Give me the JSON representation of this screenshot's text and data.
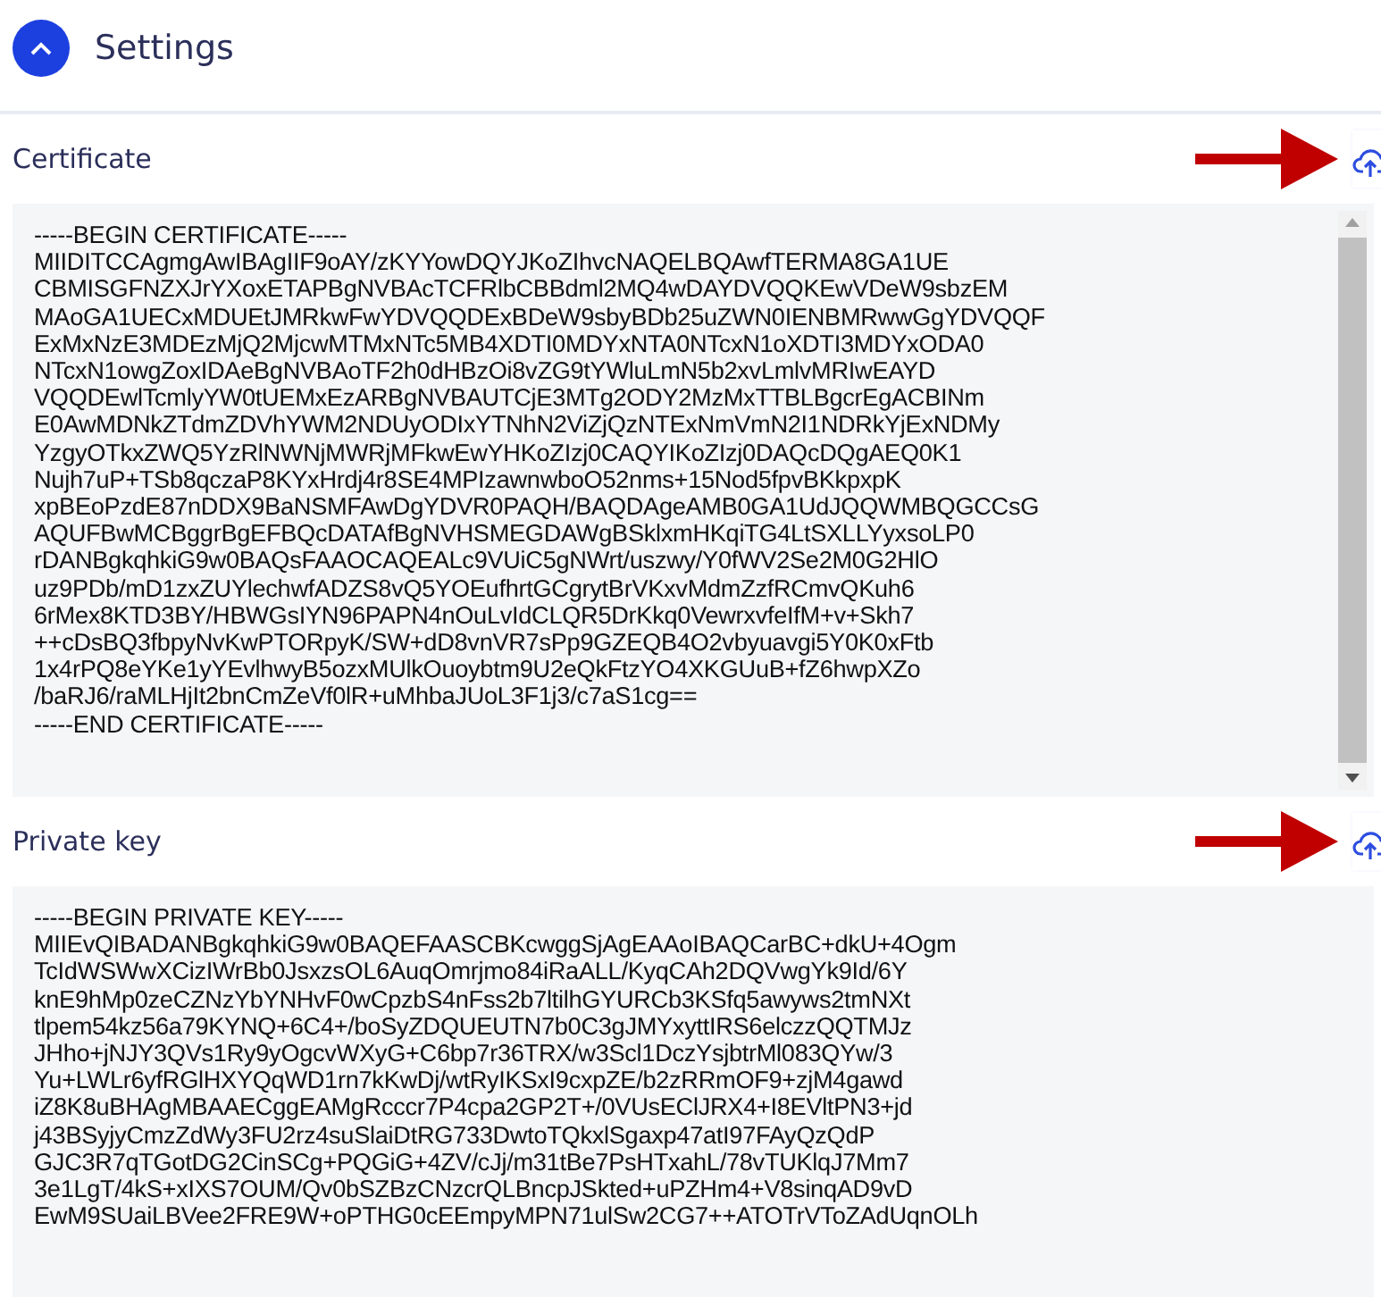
{
  "header": {
    "title": "Settings",
    "expanded": true
  },
  "fields": [
    {
      "label": "Certificate",
      "value": "-----BEGIN CERTIFICATE-----\nMIIDITCCAgmgAwIBAgIIF9oAY/zKYYowDQYJKoZIhvcNAQELBQAwfTERMA8GA1UE\nCBMISGFNZXJrYXoxETAPBgNVBAcTCFRlbCBBdml2MQ4wDAYDVQQKEwVDeW9sbzEM\nMAoGA1UECxMDUEtJMRkwFwYDVQQDExBDeW9sbyBDb25uZWN0IENBMRwwGgYDVQQF\nExMxNzE3MDEzMjQ2MjcwMTMxNTc5MB4XDTI0MDYxNTA0NTcxN1oXDTI3MDYxODA0\nNTcxN1owgZoxIDAeBgNVBAoTF2h0dHBzOi8vZG9tYWluLmN5b2xvLmlvMRIwEAYD\nVQQDEwlTcmlyYW0tUEMxEzARBgNVBAUTCjE3MTg2ODY2MzMxTTBLBgcrEgACBINm\nE0AwMDNkZTdmZDVhYWM2NDUyODIxYTNhN2ViZjQzNTExNmVmN2I1NDRkYjExNDMy\nYzgyOTkxZWQ5YzRlNWNjMWRjMFkwEwYHKoZIzj0CAQYIKoZIzj0DAQcDQgAEQ0K1\nNujh7uP+TSb8qczaP8KYxHrdj4r8SE4MPIzawnwboO52nms+15Nod5fpvBKkpxpK\nxpBEoPzdE87nDDX9BaNSMFAwDgYDVR0PAQH/BAQDAgeAMB0GA1UdJQQWMBQGCCsG\nAQUFBwMCBggrBgEFBQcDATAfBgNVHSMEGDAWgBSklxmHKqiTG4LtSXLLYyxsoLP0\nrDANBgkqhkiG9w0BAQsFAAOCAQEALc9VUiC5gNWrt/uszwy/Y0fWV2Se2M0G2HlO\nuz9PDb/mD1zxZUYlechwfADZS8vQ5YOEufhrtGCgrytBrVKxvMdmZzfRCmvQKuh6\n6rMex8KTD3BY/HBWGsIYN96PAPN4nOuLvIdCLQR5DrKkq0VewrxvfeIfM+v+Skh7\n++cDsBQ3fbpyNvKwPTORpyK/SW+dD8vnVR7sPp9GZEQB4O2vbyuavgi5Y0K0xFtb\n1x4rPQ8eYKe1yYEvlhwyB5ozxMUlkOuoybtm9U2eQkFtzYO4XKGUuB+fZ6hwpXZo\n/baRJ6/raMLHjIt2bnCmZeVf0lR+uMhbaJUoL3F1j3/c7aS1cg==\n-----END CERTIFICATE-----"
    },
    {
      "label": "Private key",
      "value": "-----BEGIN PRIVATE KEY-----\nMIIEvQIBADANBgkqhkiG9w0BAQEFAASCBKcwggSjAgEAAoIBAQCarBC+dkU+4Ogm\nTcIdWSWwXCizIWrBb0JsxzsOL6AuqOmrjmo84iRaALL/KyqCAh2DQVwgYk9Id/6Y\nknE9hMp0zeCZNzYbYNHvF0wCpzbS4nFss2b7ltilhGYURCb3KSfq5awyws2tmNXt\ntlpem54kz56a79KYNQ+6C4+/boSyZDQUEUTN7b0C3gJMYxyttIRS6elczzQQTMJz\nJHho+jNJY3QVs1Ry9yOgcvWXyG+C6bp7r36TRX/w3Scl1DczYsjbtrMl083QYw/3\nYu+LWLr6yfRGlHXYQqWD1rn7kKwDj/wtRyIKSxI9cxpZE/b2zRRmOF9+zjM4gawd\niZ8K8uBHAgMBAAECggEAMgRcccr7P4cpa2GP2T+/0VUsEClJRX4+I8EVltPN3+jd\nj43BSyjyCmzZdWy3FU2rz4suSlaiDtRG733DwtoTQkxlSgaxp47atI97FAyQzQdP\nGJC3R7qTGotDG2CinSCg+PQGiG+4ZV/cJj/m31tBe7PsHTxahL/78vTUKlqJ7Mm7\n3e1LgT/4kS+xIXS7OUM/Qv0bSZBzCNzcrQLBncpJSkted+uPZHm4+V8sinqAD9vD\nEwM9SUaiLBVee2FRE9W+oPTHG0cEEmpyMPN71ulSw2CG7++ATOTrVToZAdUqnOLh"
    }
  ]
}
